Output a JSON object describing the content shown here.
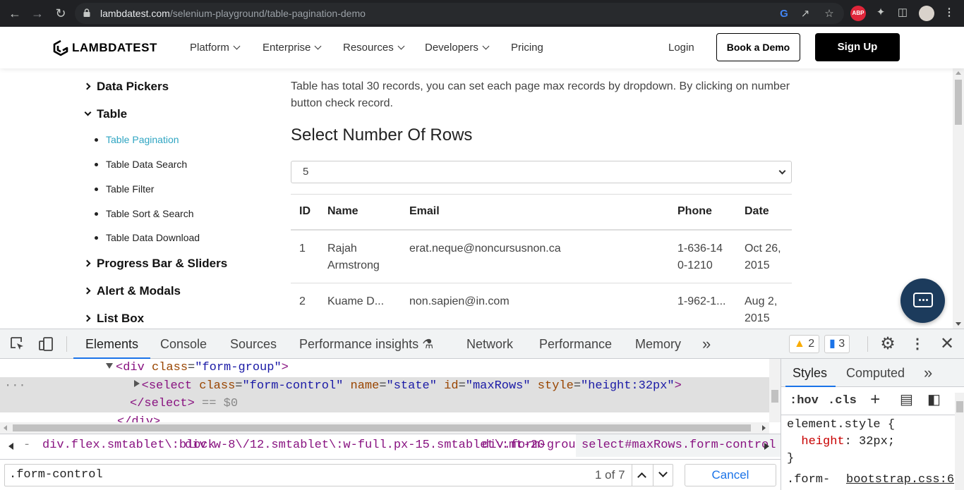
{
  "browser": {
    "url_host": "lambdatest.com",
    "url_path": "/selenium-playground/table-pagination-demo",
    "icons": [
      "back-icon",
      "forward-icon",
      "reload-icon",
      "lock-icon",
      "google-icon",
      "share-icon",
      "bookmark-star-icon",
      "adblock-plus-icon",
      "extensions-puzzle-icon",
      "side-panel-icon",
      "profile-avatar",
      "menu-kebab-icon"
    ],
    "abp_label": "ABP"
  },
  "header": {
    "logo_text": "LAMBDATEST",
    "nav": [
      {
        "label": "Platform",
        "dropdown": true
      },
      {
        "label": "Enterprise",
        "dropdown": true
      },
      {
        "label": "Resources",
        "dropdown": true
      },
      {
        "label": "Developers",
        "dropdown": true
      },
      {
        "label": "Pricing",
        "dropdown": false
      }
    ],
    "login": "Login",
    "book_demo": "Book a Demo",
    "sign_up": "Sign Up"
  },
  "sidebar": {
    "categories": [
      {
        "label": "Data Pickers",
        "expanded": false
      },
      {
        "label": "Table",
        "expanded": true
      },
      {
        "label": "Progress Bar & Sliders",
        "expanded": false
      },
      {
        "label": "Alert & Modals",
        "expanded": false
      },
      {
        "label": "List Box",
        "expanded": false
      }
    ],
    "table_items": [
      {
        "label": "Table Pagination",
        "active": true
      },
      {
        "label": "Table Data Search",
        "active": false
      },
      {
        "label": "Table Filter",
        "active": false
      },
      {
        "label": "Table Sort & Search",
        "active": false
      },
      {
        "label": "Table Data Download",
        "active": false
      }
    ],
    "active_color": "#2fa5c2"
  },
  "main": {
    "description": "Table has total 30 records, you can set each page max records by dropdown. By clicking on number button check record.",
    "rows_heading": "Select Number Of Rows",
    "rows_select_value": "5",
    "table": {
      "columns": [
        "ID",
        "Name",
        "Email",
        "Phone",
        "Date"
      ],
      "rows": [
        {
          "id": "1",
          "name": "Rajah Armstrong",
          "email": "erat.neque@noncursusnon.ca",
          "phone": "1-636-140-1210",
          "date": "Oct 26, 2015"
        },
        {
          "id": "2",
          "name": "Kuame D...",
          "email": "non.sapien@in.com",
          "phone": "1-962-1...",
          "date": "Aug 2, 2015"
        }
      ]
    },
    "chat_button_icon": "chat-bubble-icon",
    "chat_color": "#1c3b5c"
  },
  "devtools": {
    "tabs": [
      "Elements",
      "Console",
      "Sources",
      "Performance insights",
      "Network",
      "Performance",
      "Memory"
    ],
    "active_tab": "Elements",
    "more_tabs": "»",
    "warnings_count": "2",
    "messages_count": "3",
    "code": {
      "line1_tag": "div",
      "line1_attr": "class",
      "line1_val": "\"form-group\"",
      "line2_tag": "select",
      "line2_attrs": [
        {
          "name": "class",
          "value": "\"form-control\""
        },
        {
          "name": "name",
          "value": "\"state\""
        },
        {
          "name": "id",
          "value": "\"maxRows\""
        },
        {
          "name": "style",
          "value": "\"height:32px\""
        }
      ],
      "line3": "</select>",
      "line3_marker": "== $0",
      "line4": "</div>",
      "gutter_dots": "···"
    },
    "breadcrumbs": [
      "div.flex.smtablet\\:block",
      "div.w-8\\/12.smtablet\\:w-full.px-15.smtablet\\:mt-20",
      "div.form-group",
      "select#maxRows.form-control"
    ],
    "search": {
      "value": ".form-control",
      "match": "1 of 7",
      "cancel": "Cancel"
    },
    "styles": {
      "tabs": [
        "Styles",
        "Computed"
      ],
      "active_tab": "Styles",
      "hov": ":hov",
      "cls": ".cls",
      "element_style_selector": "element.style {",
      "prop_name": "height",
      "prop_value": "32px;",
      "close_brace": "}",
      "next_selector": ".form-",
      "source_link": "bootstrap.css:6"
    }
  }
}
